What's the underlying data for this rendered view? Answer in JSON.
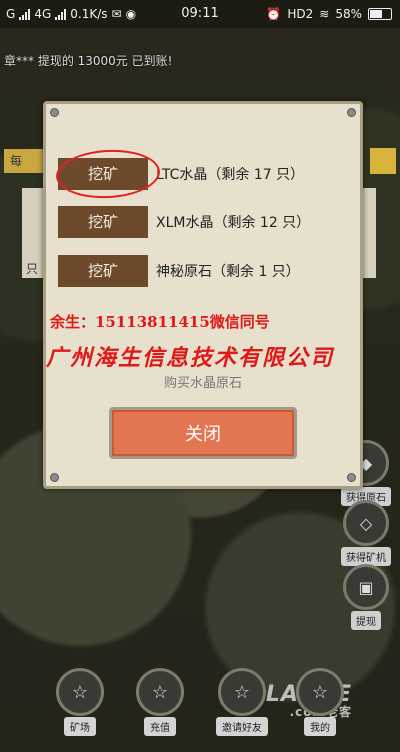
{
  "status_bar": {
    "network": "G",
    "network2": "4G",
    "speed": "0.1K/s",
    "time": "09:11",
    "hd": "HD2",
    "battery": "58%"
  },
  "marquee": "章*** 提现的 13000元 已到账!",
  "side_tab": "每",
  "side_box_text": "只",
  "dialog": {
    "rows": [
      {
        "button": "挖矿",
        "label": "LTC水晶（剩余 17 只）"
      },
      {
        "button": "挖矿",
        "label": "XLM水晶（剩余 12 只）"
      },
      {
        "button": "挖矿",
        "label": "神秘原石（剩余 1 只）"
      }
    ],
    "contact": "余生：15113811415微信同号",
    "company": "广州海生信息技术有限公司",
    "buy_text": "购买水晶原石",
    "close_label": "关闭"
  },
  "right_buttons": [
    {
      "label": "获得原石",
      "icon": "gem-icon"
    },
    {
      "label": "获得矿机",
      "icon": "diamond-icon"
    },
    {
      "label": "提现",
      "icon": "chest-icon"
    }
  ],
  "bottom_buttons": [
    {
      "label": "矿场",
      "icon": "star-icon"
    },
    {
      "label": "充值",
      "icon": "star-icon"
    },
    {
      "label": "邀请好友",
      "icon": "star-icon"
    },
    {
      "label": "我的",
      "icon": "star-icon"
    }
  ],
  "watermark": {
    "brand": "LAOKE",
    "sub": ".com老客"
  },
  "colors": {
    "mine_button": "#6e4a2c",
    "close_button": "#e27652",
    "ad_text": "#e01818"
  }
}
